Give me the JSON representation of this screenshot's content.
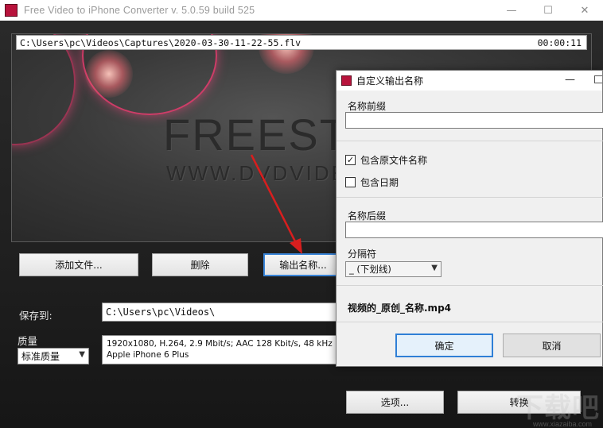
{
  "window": {
    "title": "Free Video to iPhone Converter  v. 5.0.59 build 525",
    "minimize": "—",
    "maximize": "☐",
    "close": "✕"
  },
  "preview": {
    "file_path": "C:\\Users\\pc\\Videos\\Captures\\2020-03-30-11-22-55.flv",
    "duration": "00:00:11",
    "watermark_main": "FREESTU",
    "watermark_sub": "WWW.DVDVIDEOS"
  },
  "buttons": {
    "add_files": "添加文件...",
    "delete": "删除",
    "output_name": "输出名称...",
    "options": "选项...",
    "convert": "转换"
  },
  "save_to": {
    "label": "保存到:",
    "path": "C:\\Users\\pc\\Videos\\"
  },
  "quality": {
    "label": "质量",
    "selected": "标准质量",
    "info_line1": "1920x1080, H.264, 2.9 Mbit/s; AAC 128 Kbit/s, 48 kHz",
    "info_line2": "Apple iPhone 6 Plus"
  },
  "dialog": {
    "title": "自定义输出名称",
    "minimize": "—",
    "prefix_label": "名称前缀",
    "prefix_value": "",
    "include_original_label": "包含原文件名称",
    "include_original_checked": true,
    "include_date_label": "包含日期",
    "include_date_checked": false,
    "suffix_label": "名称后缀",
    "suffix_value": "",
    "separator_label": "分隔符",
    "separator_selected": "_ (下划线)",
    "preview_name": "视频的_原创_名称.mp4",
    "ok": "确定",
    "cancel": "取消"
  },
  "corner_logo": "下载吧",
  "corner_url": "www.xiazaiba.com",
  "colors": {
    "accent_focus": "#2f7fd6",
    "app_icon": "#b8133c",
    "annotation_arrow": "#d81e1e"
  },
  "icons": {
    "app": "app-icon",
    "dropdown": "chevron-down-icon",
    "check": "check-icon"
  }
}
